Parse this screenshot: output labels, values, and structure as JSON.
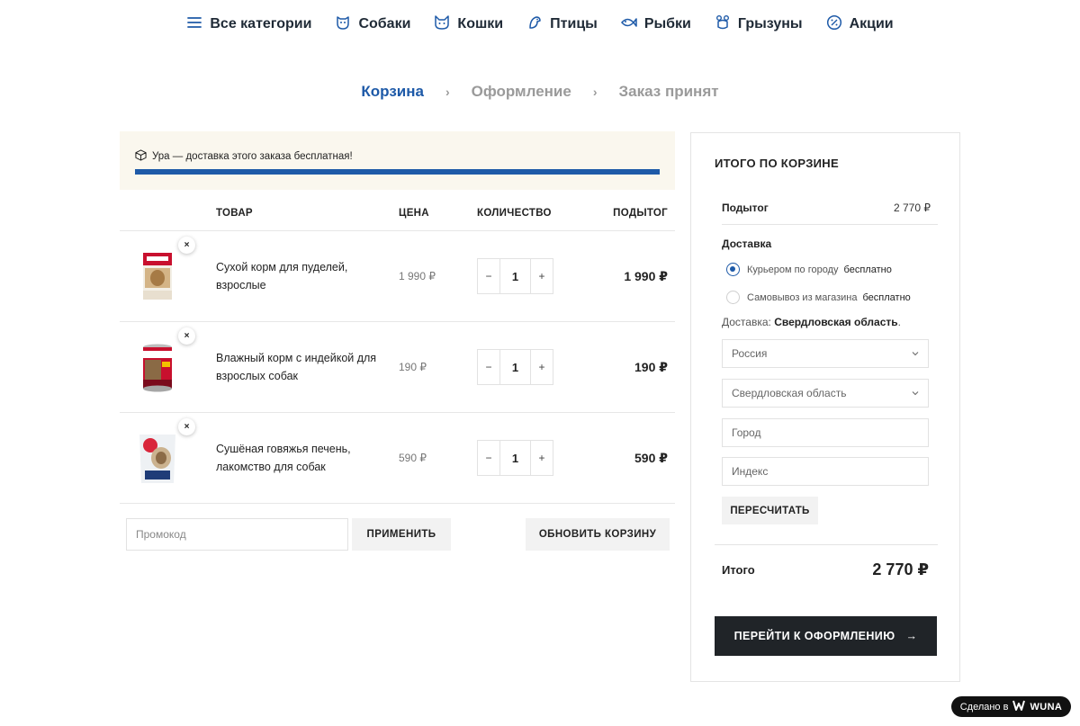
{
  "nav": {
    "items": [
      {
        "label": "Все категории",
        "icon": "menu-icon"
      },
      {
        "label": "Собаки",
        "icon": "dog-icon"
      },
      {
        "label": "Кошки",
        "icon": "cat-icon"
      },
      {
        "label": "Птицы",
        "icon": "bird-icon"
      },
      {
        "label": "Рыбки",
        "icon": "fish-icon"
      },
      {
        "label": "Грызуны",
        "icon": "rodent-icon"
      },
      {
        "label": "Акции",
        "icon": "discount-icon"
      }
    ]
  },
  "steps": {
    "cart": "Корзина",
    "checkout": "Оформление",
    "done": "Заказ принят",
    "separator": "›"
  },
  "banner": {
    "text": "Ура — доставка этого заказа бесплатная!",
    "progress_percent": 100,
    "icon": "box-icon"
  },
  "table": {
    "headers": {
      "product": "ТОВАР",
      "price": "ЦЕНА",
      "quantity": "КОЛИЧЕСТВО",
      "subtotal": "ПОДЫТОГ"
    },
    "remove_symbol": "×",
    "minus": "−",
    "plus": "+",
    "rows": [
      {
        "name": "Сухой корм для пуделей, взрослые",
        "price": "1 990 ₽",
        "qty": "1",
        "subtotal": "1 990 ₽"
      },
      {
        "name": "Влажный корм с индейкой для взрослых собак",
        "price": "190 ₽",
        "qty": "1",
        "subtotal": "190 ₽"
      },
      {
        "name": "Сушёная говяжья печень, лакомство для собак",
        "price": "590 ₽",
        "qty": "1",
        "subtotal": "590 ₽"
      }
    ]
  },
  "coupon": {
    "placeholder": "Промокод",
    "apply_label": "ПРИМЕНИТЬ",
    "update_label": "ОБНОВИТЬ КОРЗИНУ"
  },
  "totals": {
    "title": "ИТОГО ПО КОРЗИНЕ",
    "subtotal_label": "Подытог",
    "subtotal_value": "2 770 ₽",
    "shipping_label": "Доставка",
    "options": [
      {
        "label": "Курьером по городу",
        "price": "бесплатно",
        "checked": true
      },
      {
        "label": "Самовывоз из магазина",
        "price": "бесплатно",
        "checked": false
      }
    ],
    "destination_prefix": "Доставка:",
    "destination_region": "Свердловская область",
    "destination_suffix": ".",
    "country": "Россия",
    "region": "Свердловская область",
    "city_placeholder": "Город",
    "zip_placeholder": "Индекс",
    "recalc_label": "ПЕРЕСЧИТАТЬ",
    "total_label": "Итого",
    "total_value": "2 770 ₽",
    "checkout_label": "ПЕРЕЙТИ К ОФОРМЛЕНИЮ",
    "checkout_arrow": "→"
  },
  "badge": {
    "prefix": "Сделано в",
    "brand": "WUNA"
  },
  "colors": {
    "accent": "#1e5aa8",
    "banner_bg": "#faf7ee",
    "checkout_bg": "#202428"
  }
}
